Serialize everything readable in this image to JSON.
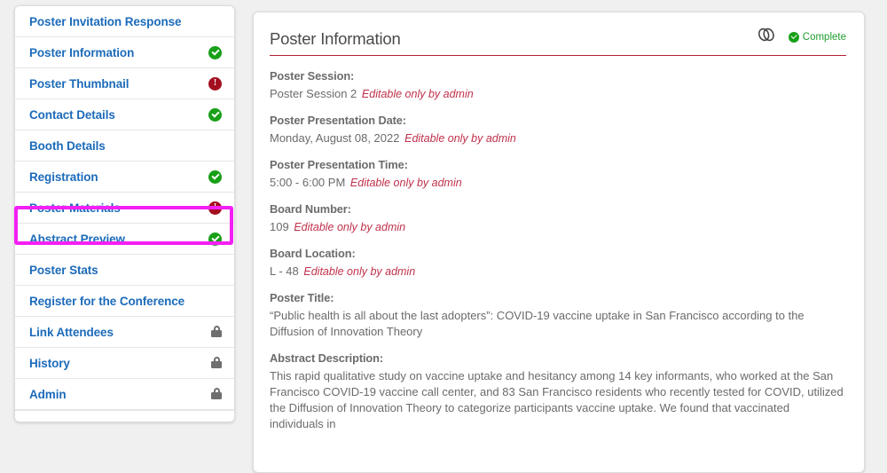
{
  "sidebar": {
    "items": [
      {
        "label": "Poster Invitation Response",
        "status": "none"
      },
      {
        "label": "Poster Information",
        "status": "complete"
      },
      {
        "label": "Poster Thumbnail",
        "status": "alert"
      },
      {
        "label": "Contact Details",
        "status": "complete"
      },
      {
        "label": "Booth Details",
        "status": "none"
      },
      {
        "label": "Registration",
        "status": "complete"
      },
      {
        "label": "Poster Materials",
        "status": "alert",
        "highlighted": true
      },
      {
        "label": "Abstract Preview",
        "status": "complete"
      },
      {
        "label": "Poster Stats",
        "status": "none"
      },
      {
        "label": "Register for the Conference",
        "status": "none"
      },
      {
        "label": "Link Attendees",
        "status": "locked"
      },
      {
        "label": "History",
        "status": "locked"
      },
      {
        "label": "Admin",
        "status": "locked"
      }
    ]
  },
  "main": {
    "title": "Poster Information",
    "link_icon": "chain-link-icon",
    "status_badge": "Complete",
    "fields": [
      {
        "label": "Poster Session:",
        "value": "Poster Session 2",
        "note": "Editable only by admin"
      },
      {
        "label": "Poster Presentation Date:",
        "value": "Monday, August 08, 2022",
        "note": "Editable only by admin"
      },
      {
        "label": "Poster Presentation Time:",
        "value": "5:00 - 6:00 PM",
        "note": "Editable only by admin"
      },
      {
        "label": "Board Number:",
        "value": "109",
        "note": "Editable only by admin"
      },
      {
        "label": "Board Location:",
        "value": "L - 48",
        "note": "Editable only by admin"
      },
      {
        "label": "Poster Title:",
        "value": "“Public health is all about the last adopters”: COVID-19 vaccine uptake in San Francisco according to the Diffusion of Innovation Theory",
        "note": ""
      },
      {
        "label": "Abstract Description:",
        "value": "This rapid qualitative study on vaccine uptake and hesitancy among 14 key informants, who worked at the San Francisco COVID-19 vaccine call center, and 83 San Francisco residents who recently tested for COVID, utilized the Diffusion of Innovation Theory to categorize participants vaccine uptake. We found that vaccinated individuals in",
        "note": ""
      }
    ]
  },
  "colors": {
    "nav_link": "#1c6bba",
    "accent_underline": "#b51f35",
    "complete_green": "#18a018",
    "alert_red": "#a30f1f",
    "highlight_magenta": "#f41ff4",
    "admin_note_red": "#c0304a",
    "page_background": "#f0f0f0"
  }
}
